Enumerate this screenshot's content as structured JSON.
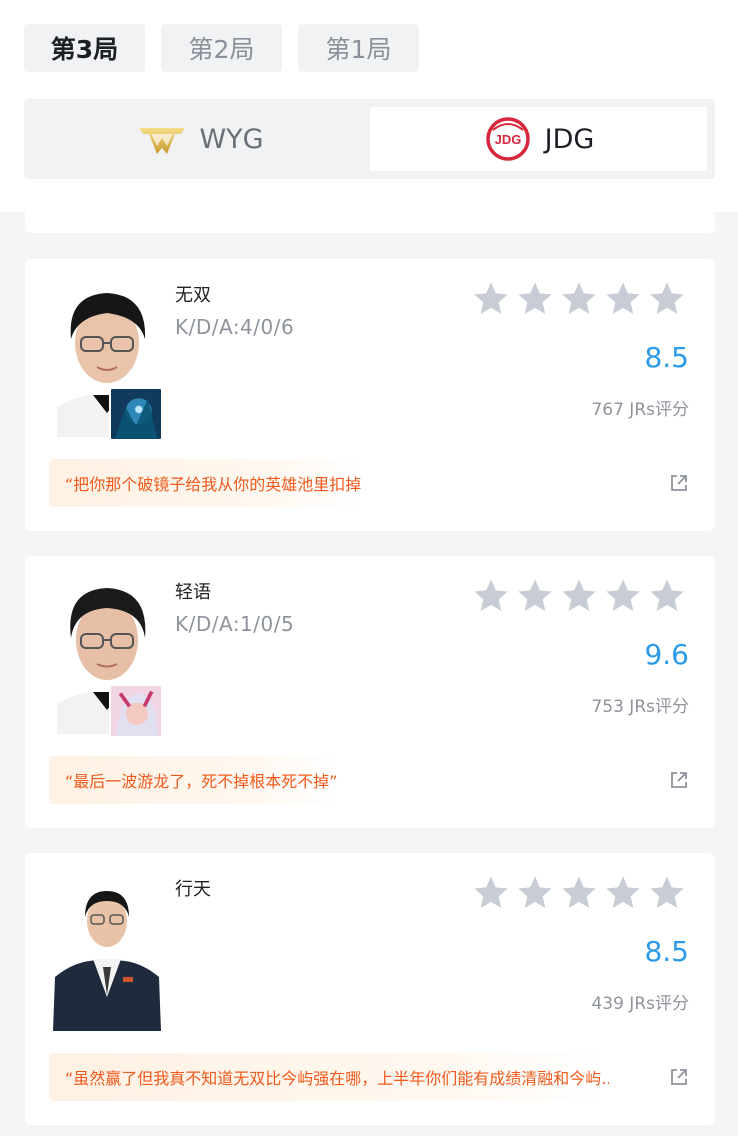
{
  "game_tabs": [
    {
      "label": "第3局",
      "active": true
    },
    {
      "label": "第2局",
      "active": false
    },
    {
      "label": "第1局",
      "active": false
    }
  ],
  "teams": {
    "left": {
      "name": "WYG",
      "logo_icon": "wyg-logo-icon",
      "selected": false
    },
    "right": {
      "name": "JDG",
      "logo_icon": "jdg-logo-icon",
      "selected": true
    }
  },
  "colors": {
    "accent_blue": "#2b9be8",
    "comment_orange": "#f05a1c",
    "star_gray": "#c8ccd4",
    "page_bg": "#f4f5f7"
  },
  "players": [
    {
      "name": "无双",
      "kda": "K/D/A:4/0/6",
      "stars_filled": 0,
      "stars_total": 5,
      "score": "8.5",
      "rating_count": "767 JRs评分",
      "comment": "“把你那个破镜子给我从你的英雄池里扣掉”",
      "hero_icon": "hero-portrait-icon"
    },
    {
      "name": "轻语",
      "kda": "K/D/A:1/0/5",
      "stars_filled": 0,
      "stars_total": 5,
      "score": "9.6",
      "rating_count": "753 JRs评分",
      "comment": "“最后一波游龙了，死不掉根本死不掉”",
      "hero_icon": "hero-portrait-icon"
    },
    {
      "name": "行天",
      "kda": "",
      "stars_filled": 0,
      "stars_total": 5,
      "score": "8.5",
      "rating_count": "439 JRs评分",
      "comment": "“虽然赢了但我真不知道无双比今屿强在哪，上半年你们能有成绩清融和今屿...",
      "hero_icon": ""
    }
  ]
}
